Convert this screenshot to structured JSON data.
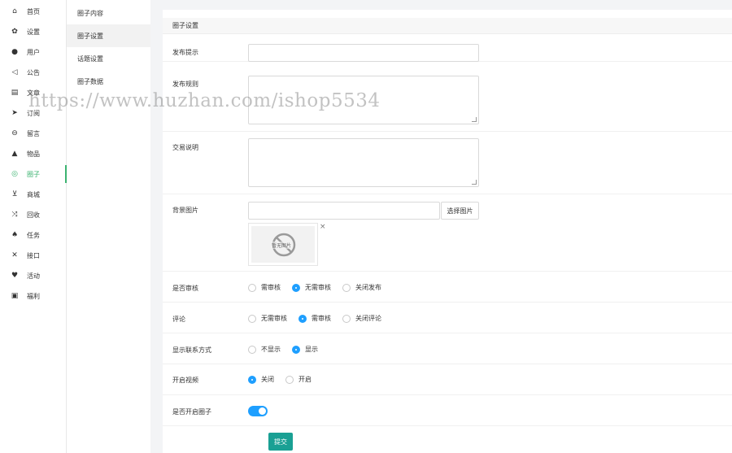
{
  "nav": {
    "items": [
      {
        "label": "首页",
        "icon": "home-icon",
        "glyph": "⌂"
      },
      {
        "label": "设置",
        "icon": "gear-icon",
        "glyph": "✿"
      },
      {
        "label": "用户",
        "icon": "user-icon",
        "glyph": "●"
      },
      {
        "label": "公告",
        "icon": "speaker-icon",
        "glyph": "◁"
      },
      {
        "label": "文章",
        "icon": "document-icon",
        "glyph": "▤"
      },
      {
        "label": "订阅",
        "icon": "send-icon",
        "glyph": "➤"
      },
      {
        "label": "留言",
        "icon": "chat-icon",
        "glyph": "⊖"
      },
      {
        "label": "物品",
        "icon": "fire-icon",
        "glyph": "▲"
      },
      {
        "label": "圈子",
        "icon": "globe-icon",
        "glyph": "◎"
      },
      {
        "label": "商城",
        "icon": "cart-icon",
        "glyph": "⊻"
      },
      {
        "label": "回收",
        "icon": "shuffle-icon",
        "glyph": "⤨"
      },
      {
        "label": "任务",
        "icon": "bell-icon",
        "glyph": "♠"
      },
      {
        "label": "接口",
        "icon": "tools-icon",
        "glyph": "✕"
      },
      {
        "label": "活动",
        "icon": "heart-icon",
        "glyph": "♥"
      },
      {
        "label": "福利",
        "icon": "gift-icon",
        "glyph": "▣"
      }
    ],
    "active_index": 8
  },
  "subnav": {
    "items": [
      "圈子内容",
      "圈子设置",
      "话题设置",
      "圈子数据"
    ],
    "active_index": 1
  },
  "panel": {
    "title": "圈子设置"
  },
  "form": {
    "publish_tip_label": "发布提示",
    "publish_tip_value": "",
    "publish_rules_label": "发布规则",
    "publish_rules_value": "",
    "trade_desc_label": "交易说明",
    "trade_desc_value": "",
    "bg_image_label": "背景图片",
    "bg_image_value": "",
    "select_image_button": "选择图片",
    "no_image_text": "暂无图片",
    "delete_glyph": "×",
    "review_label": "是否审核",
    "review_options": [
      "需审核",
      "无需审核",
      "关闭发布"
    ],
    "review_selected": 1,
    "comment_label": "评论",
    "comment_options": [
      "无需审核",
      "需审核",
      "关闭评论"
    ],
    "comment_selected": 1,
    "contact_label": "显示联系方式",
    "contact_options": [
      "不显示",
      "显示"
    ],
    "contact_selected": 1,
    "video_label": "开启视频",
    "video_options": [
      "关闭",
      "开启"
    ],
    "video_selected": 0,
    "enable_circle_label": "是否开启圈子",
    "enable_circle_on": true,
    "submit_label": "提交"
  },
  "watermark": "https://www.huzhan.com/ishop5534",
  "colors": {
    "accent_green": "#3cb371",
    "radio_blue": "#1e9fff",
    "submit_teal": "#1aa094"
  }
}
